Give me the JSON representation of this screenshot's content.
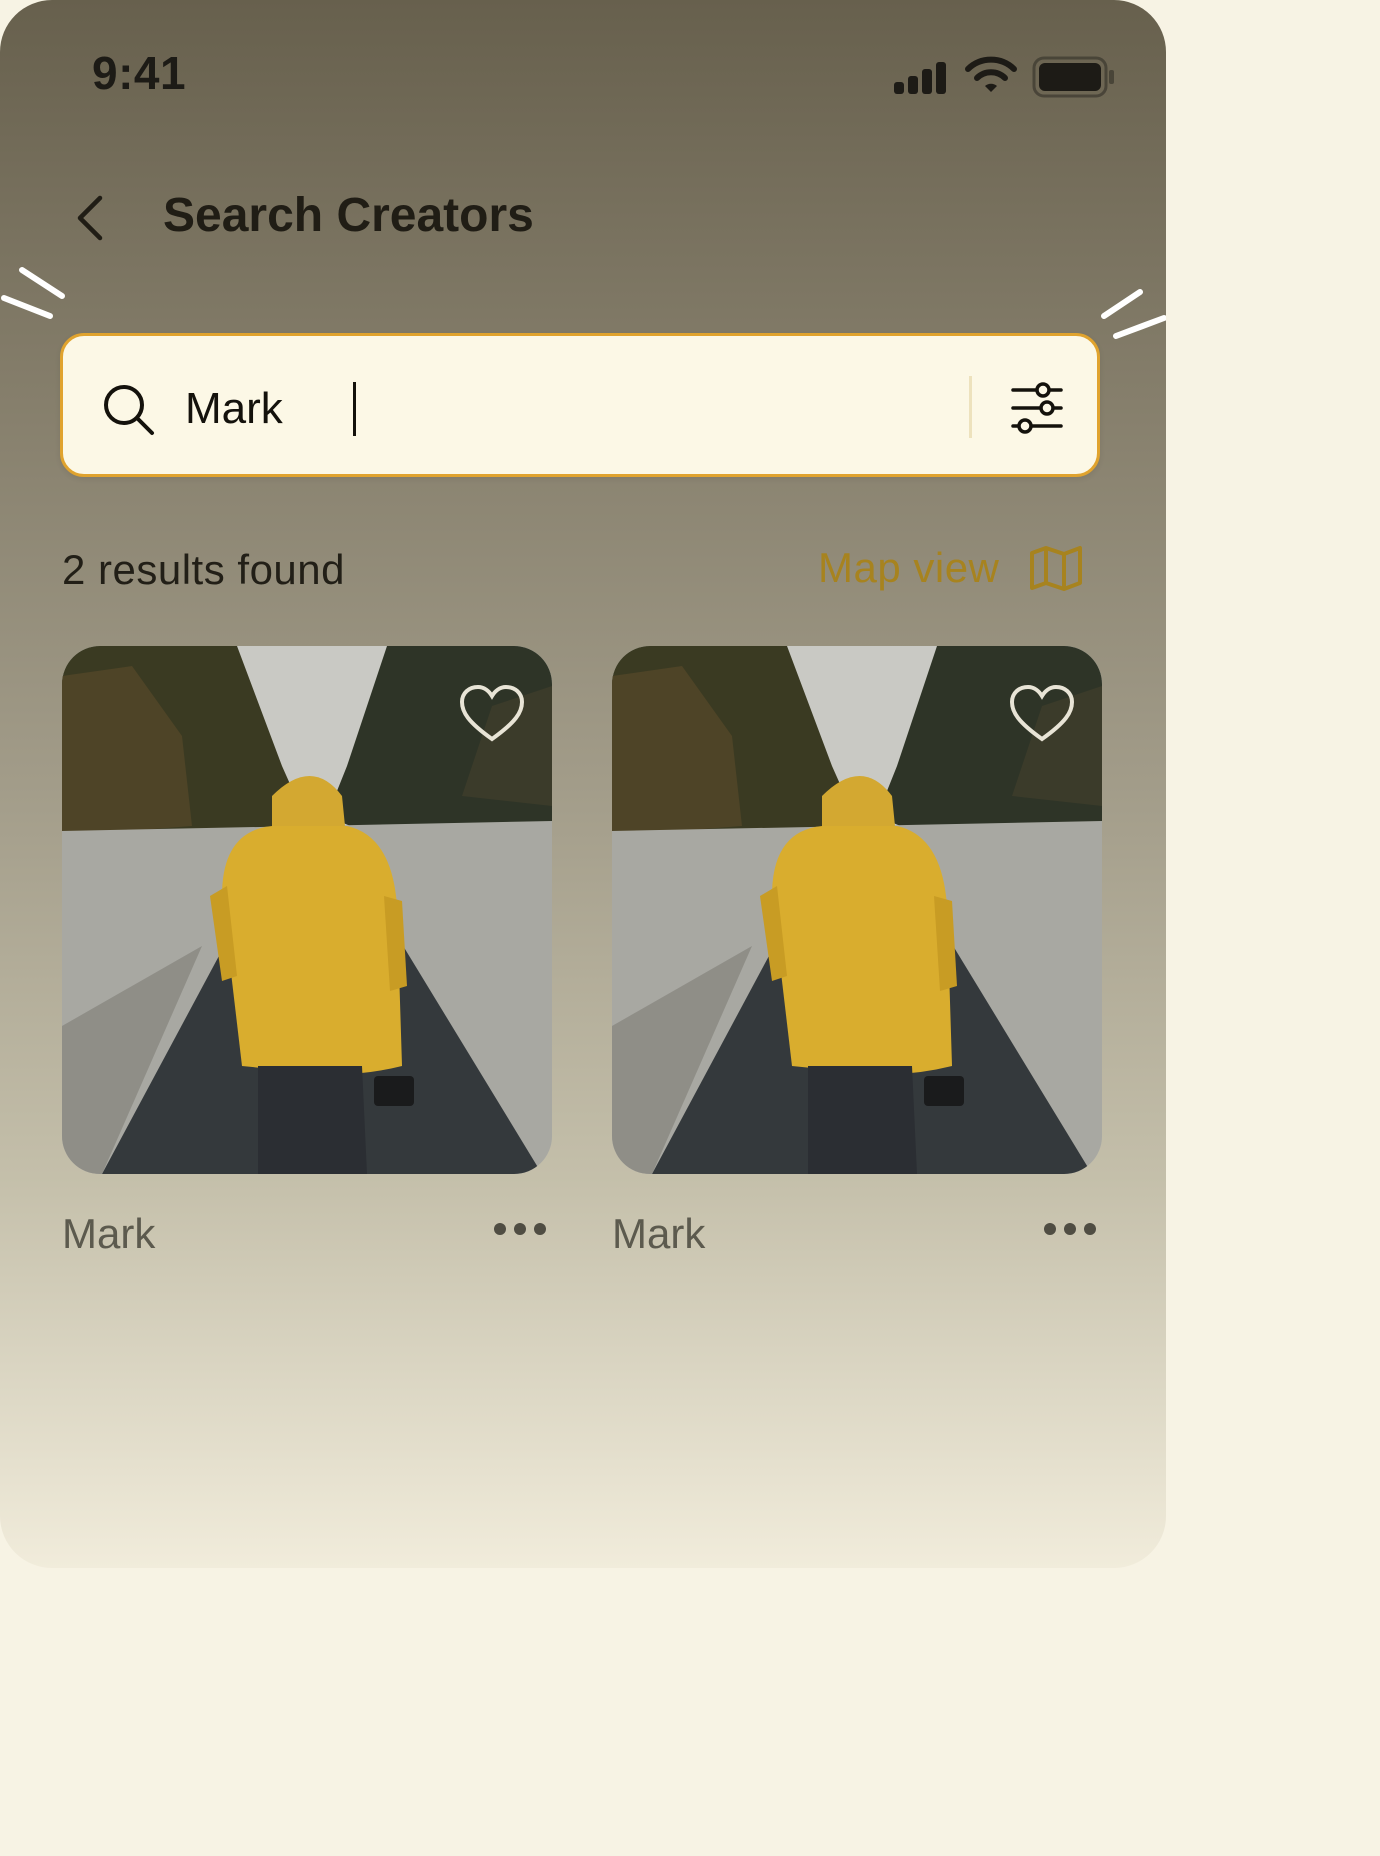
{
  "status_bar": {
    "time": "9:41"
  },
  "header": {
    "title": "Search Creators"
  },
  "search": {
    "value": "Mark"
  },
  "results": {
    "count_text": "2 results found",
    "map_view_label": "Map view"
  },
  "creators": [
    {
      "name": "Mark"
    },
    {
      "name": "Mark"
    }
  ],
  "colors": {
    "accent": "#e0a32e",
    "map_link": "#a7831f",
    "search_bg": "#fcf8e6"
  }
}
